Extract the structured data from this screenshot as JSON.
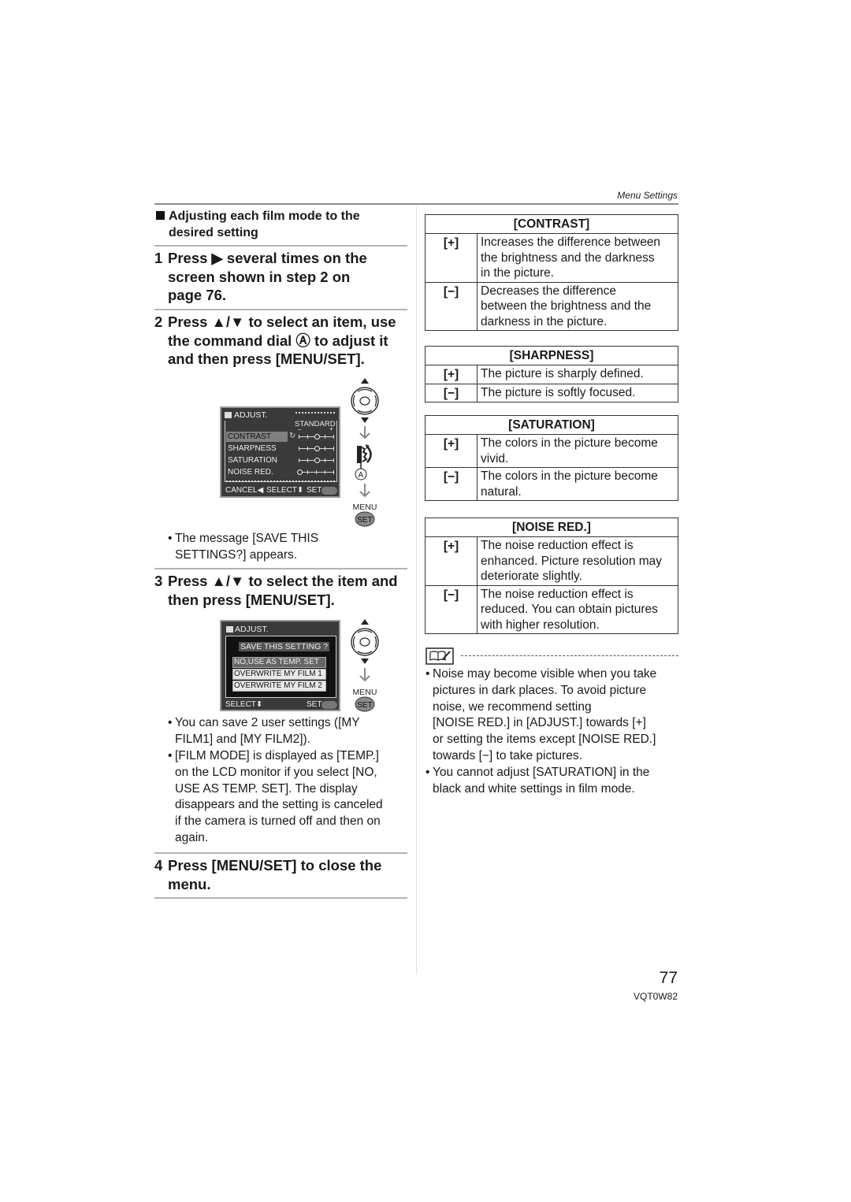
{
  "header": {
    "running_head": "Menu Settings"
  },
  "left": {
    "section_title": "Adjusting each film mode to the desired setting",
    "steps": [
      {
        "num": "1",
        "lines": [
          "Press ▶ several times on the",
          "screen shown in step 2 on",
          "page 76."
        ]
      },
      {
        "num": "2",
        "lines": [
          "Press ▲/▼ to select an item, use",
          "the command dial Ⓐ to adjust it",
          "and then press [MENU/SET]."
        ]
      },
      {
        "num": "3",
        "lines": [
          "Press ▲/▼ to select the item and",
          "then press [MENU/SET]."
        ]
      },
      {
        "num": "4",
        "lines": [
          "Press [MENU/SET] to close the",
          "menu."
        ]
      }
    ],
    "bullets_step2": [
      {
        "lines": [
          "The message [SAVE THIS",
          "SETTINGS?] appears."
        ]
      }
    ],
    "bullets_step3": [
      {
        "lines": [
          "You can save 2 user settings ([MY",
          "FILM1] and [MY FILM2])."
        ]
      },
      {
        "lines": [
          "[FILM MODE] is displayed as [TEMP.]",
          "on the LCD monitor if you select [NO,",
          "USE AS TEMP. SET]. The display",
          "disappears and the setting is canceled",
          "if the camera is turned off and then on",
          "again."
        ]
      }
    ],
    "screen1": {
      "title": "ADJUST.",
      "preset": "STANDARD",
      "scale_minus": "−",
      "scale_plus": "+",
      "items": [
        {
          "label": "CONTRAST",
          "value": 0.5,
          "selected": true
        },
        {
          "label": "SHARPNESS",
          "value": 0.5,
          "selected": false
        },
        {
          "label": "SATURATION",
          "value": 0.5,
          "selected": false
        },
        {
          "label": "NOISE RED.",
          "value": 0.0,
          "selected": false
        }
      ],
      "footer": {
        "cancel": "CANCEL◀",
        "select": "SELECT⬍",
        "set": "SET"
      }
    },
    "screen2": {
      "title": "ADJUST.",
      "prompt": "SAVE THIS SETTING ?",
      "options": [
        {
          "label": "NO,USE AS TEMP. SET",
          "selected": true
        },
        {
          "label": "OVERWRITE MY FILM 1",
          "selected": false
        },
        {
          "label": "OVERWRITE MY FILM 2",
          "selected": false
        }
      ],
      "footer": {
        "select": "SELECT⬍",
        "set": "SET"
      }
    },
    "controls": {
      "menu_label": "MENU",
      "set_label": "SET",
      "dial_label": "A"
    }
  },
  "right": {
    "tables": [
      {
        "title": "[CONTRAST]",
        "rows": [
          {
            "sym": "[+]",
            "lines": [
              "Increases the difference between",
              "the brightness and the darkness",
              "in the picture."
            ]
          },
          {
            "sym": "[−]",
            "lines": [
              "Decreases the difference",
              "between the brightness and the",
              "darkness in the picture."
            ]
          }
        ]
      },
      {
        "title": "[SHARPNESS]",
        "rows": [
          {
            "sym": "[+]",
            "lines": [
              "The picture is sharply defined."
            ]
          },
          {
            "sym": "[−]",
            "lines": [
              "The picture is softly focused."
            ]
          }
        ]
      },
      {
        "title": "[SATURATION]",
        "rows": [
          {
            "sym": "[+]",
            "lines": [
              "The colors in the picture become",
              "vivid."
            ]
          },
          {
            "sym": "[−]",
            "lines": [
              "The colors in the picture become",
              "natural."
            ]
          }
        ]
      },
      {
        "title": "[NOISE RED.]",
        "rows": [
          {
            "sym": "[+]",
            "lines": [
              "The noise reduction effect is",
              "enhanced. Picture resolution may",
              "deteriorate slightly."
            ]
          },
          {
            "sym": "[−]",
            "lines": [
              "The noise reduction effect is",
              "reduced. You can obtain pictures",
              "with higher resolution."
            ]
          }
        ]
      }
    ],
    "notes": [
      {
        "lines": [
          "Noise may become visible when you take",
          "pictures in dark places. To avoid picture",
          "noise, we recommend setting",
          "[NOISE RED.] in [ADJUST.] towards [+]",
          "or setting the items except [NOISE RED.]",
          "towards [−] to take pictures."
        ]
      },
      {
        "lines": [
          "You cannot adjust [SATURATION] in the",
          "black and white settings in film mode."
        ]
      }
    ]
  },
  "footer": {
    "page_number": "77",
    "doc_code": "VQT0W82"
  }
}
